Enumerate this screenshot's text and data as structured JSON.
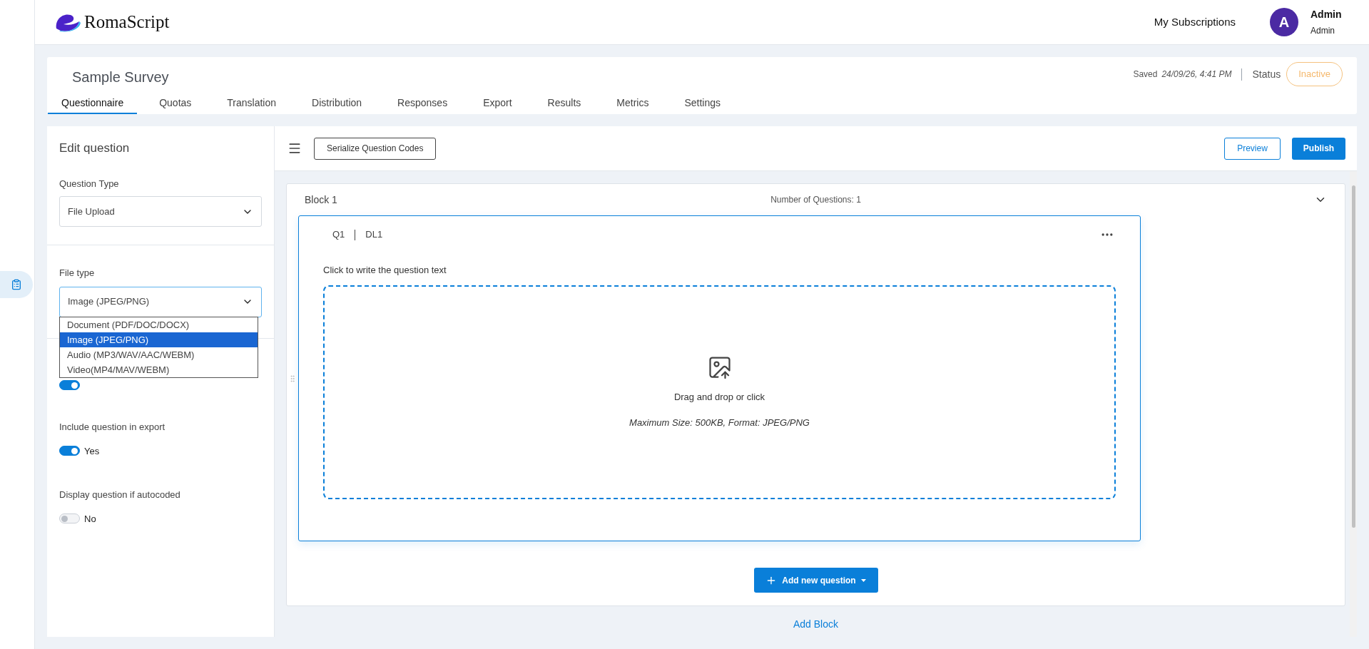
{
  "brand": {
    "name": "RomaScript"
  },
  "header": {
    "subscriptions": "My Subscriptions",
    "user": {
      "initial": "A",
      "name": "Admin",
      "role": "Admin"
    }
  },
  "rail": {
    "items": [
      {
        "selected": true
      }
    ]
  },
  "survey": {
    "title": "Sample Survey",
    "saved_label": "Saved",
    "saved_time": "24/09/26, 4:41 PM",
    "status_label": "Status",
    "status": "Inactive"
  },
  "tabs": [
    {
      "label": "Questionnaire",
      "selected": true
    },
    {
      "label": "Quotas",
      "selected": false
    },
    {
      "label": "Translation",
      "selected": false
    },
    {
      "label": "Distribution",
      "selected": false
    },
    {
      "label": "Responses",
      "selected": false
    },
    {
      "label": "Export",
      "selected": false
    },
    {
      "label": "Results",
      "selected": false
    },
    {
      "label": "Metrics",
      "selected": false
    },
    {
      "label": "Settings",
      "selected": false
    }
  ],
  "editor": {
    "title": "Edit question",
    "question_type": {
      "label": "Question Type",
      "value": "File Upload"
    },
    "file_type": {
      "label": "File type",
      "value": "Image (JPEG/PNG)",
      "expanded": true,
      "options": [
        {
          "label": "Document (PDF/DOC/DOCX)",
          "selected": false
        },
        {
          "label": "Image (JPEG/PNG)",
          "selected": true
        },
        {
          "label": "Audio (MP3/WAV/AAC/WEBM)",
          "selected": false
        },
        {
          "label": "Video(MP4/MAV/WEBM)",
          "selected": false
        }
      ]
    },
    "hidden_setting": {
      "on": true
    },
    "settings": [
      {
        "label": "Include question in export",
        "on": true,
        "value": "Yes"
      },
      {
        "label": "Display question if autocoded",
        "on": false,
        "value": "No"
      }
    ]
  },
  "toolbar": {
    "serialize": "Serialize Question Codes",
    "preview": "Preview",
    "publish": "Publish"
  },
  "block": {
    "title": "Block 1",
    "count": "Number of Questions: 1",
    "expanded": true,
    "questions": [
      {
        "code": "Q1",
        "label": "DL1",
        "prompt": "Click to write the question text",
        "upload": {
          "hint": "Drag and drop or click",
          "limits": "Maximum Size: 500KB, Format: JPEG/PNG"
        }
      }
    ]
  },
  "add_question": "Add new question",
  "add_block": "Add Block"
}
